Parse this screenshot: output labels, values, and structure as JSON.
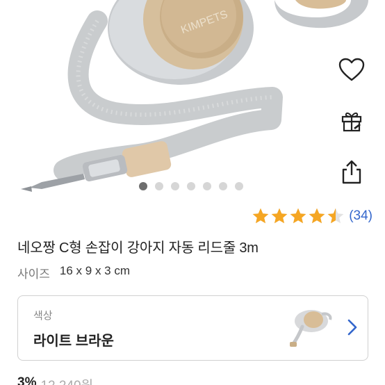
{
  "product": {
    "brand_logo_text": "KIMPETS",
    "title": "네오짱 C형 손잡이 강아지 자동 리드줄 3m",
    "size_label": "사이즈",
    "size_value": "16 x 9 x 3 cm"
  },
  "gallery": {
    "slide_count": 7,
    "active_index": 0
  },
  "actions": {
    "wishlist_icon": "heart-icon",
    "gift_icon": "gift-icon",
    "share_icon": "share-icon"
  },
  "rating": {
    "stars": 4.5,
    "count_text": "(34)",
    "star_color": "#f5a623",
    "count_color": "#3366cc"
  },
  "option": {
    "label": "색상",
    "value": "라이트 브라운",
    "chevron_color": "#3366cc"
  },
  "price": {
    "discount": "3%",
    "original": "12,240원"
  }
}
